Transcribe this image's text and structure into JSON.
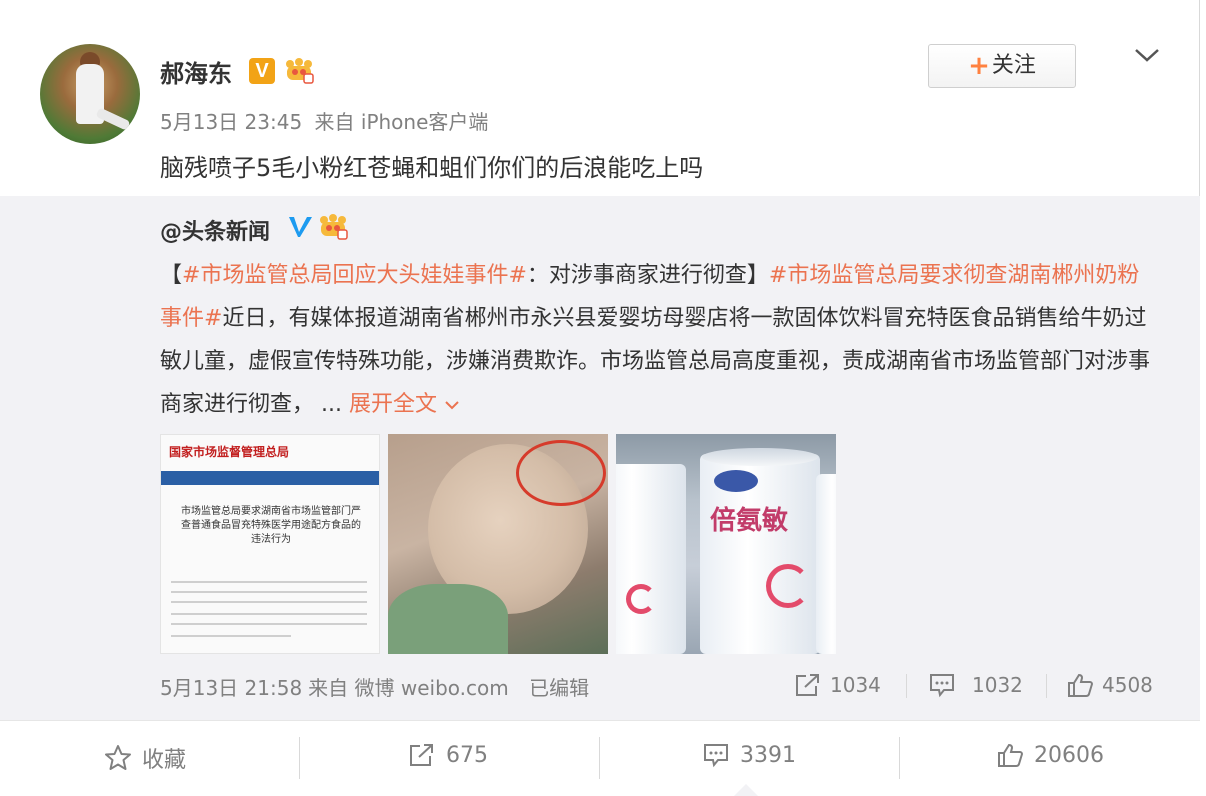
{
  "author": {
    "name": "郝海东",
    "badges": [
      "v-orange-badge",
      "crown-icon"
    ]
  },
  "post": {
    "time": "5月13日 23:45",
    "source": "来自 iPhone客户端",
    "text": "脑残喷子5毛小粉红苍蝇和蛆们你们的后浪能吃上吗"
  },
  "follow_button": {
    "plus": "+",
    "label": "关注"
  },
  "repost": {
    "user": "@头条新闻",
    "text_parts": {
      "bracket_open": "【",
      "topic1": "#市场监管总局回应大头娃娃事件#",
      "after_topic1": "：对涉事商家进行彻查】",
      "topic2": "#市场监管总局要求彻查湖南郴州奶粉事件#",
      "body": "近日，有媒体报道湖南省郴州市永兴县爱婴坊母婴店将一款固体饮料冒充特医食品销售给牛奶过敏儿童，虚假宣传特殊功能，涉嫌消费欺诈。市场监管总局高度重视，责成湖南省市场监管部门对涉事商家进行彻查，",
      "ellipsis": " ... ",
      "expand": "展开全文"
    },
    "images": {
      "img1_header": "国家市场监督管理总局",
      "img1_title": "市场监管总局要求湖南省市场监管部门严查普通食品冒充特殊医学用途配方食品的违法行为",
      "img3_brand": "倍氨敏"
    },
    "time": "5月13日 21:58",
    "source": "来自 微博 weibo.com",
    "edited": "已编辑",
    "reposts": "1034",
    "comments": "1032",
    "likes": "4508"
  },
  "bottom": {
    "favorite": "收藏",
    "reposts": "675",
    "comments": "3391",
    "likes": "20606"
  },
  "colors": {
    "topic": "#eb7350",
    "v_orange": "#f2a316",
    "v_blue": "#1d9bf0",
    "muted": "#808080"
  }
}
